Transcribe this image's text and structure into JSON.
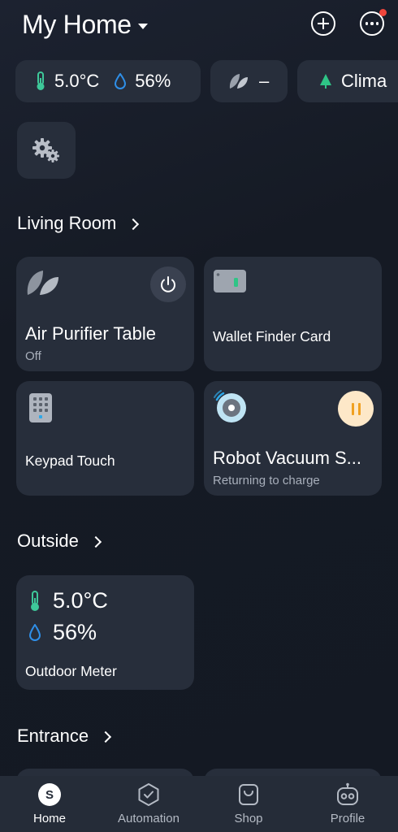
{
  "header": {
    "title": "My Home"
  },
  "chips": {
    "temperature": "5.0°C",
    "humidity": "56%",
    "air_quality": "–",
    "climate_label": "Clima"
  },
  "sections": {
    "living_room": "Living Room",
    "outside": "Outside",
    "entrance": "Entrance"
  },
  "devices": {
    "air_purifier": {
      "name": "Air Purifier Table",
      "status": "Off"
    },
    "wallet_finder": {
      "name": "Wallet Finder Card"
    },
    "keypad": {
      "name": "Keypad Touch"
    },
    "robot_vacuum": {
      "name": "Robot Vacuum S...",
      "status": "Returning to charge"
    },
    "outdoor_meter": {
      "name": "Outdoor Meter",
      "temperature": "5.0°C",
      "humidity": "56%"
    }
  },
  "tabs": [
    {
      "label": "Home",
      "avatar_letter": "S"
    },
    {
      "label": "Automation"
    },
    {
      "label": "Shop"
    },
    {
      "label": "Profile"
    }
  ],
  "colors": {
    "background": "#161b26",
    "card": "#272e3b",
    "thermo_green": "#3ec99a",
    "drop_blue": "#2f8fe8",
    "notification_red": "#f0463c",
    "pause_amber": "#f0a020",
    "climate_green": "#2fc486"
  },
  "icons": {
    "header": [
      "plus-circle-icon",
      "more-dots-icon"
    ],
    "chips": [
      "thermometer-icon",
      "water-drop-icon",
      "leaf-icon",
      "tree-icon"
    ],
    "devices": [
      "leaf-icon",
      "power-icon",
      "card-icon",
      "keypad-icon",
      "robot-vacuum-icon",
      "pause-icon"
    ],
    "tabs": [
      "home-avatar-icon",
      "automation-icon",
      "shop-icon",
      "profile-robot-icon"
    ]
  }
}
